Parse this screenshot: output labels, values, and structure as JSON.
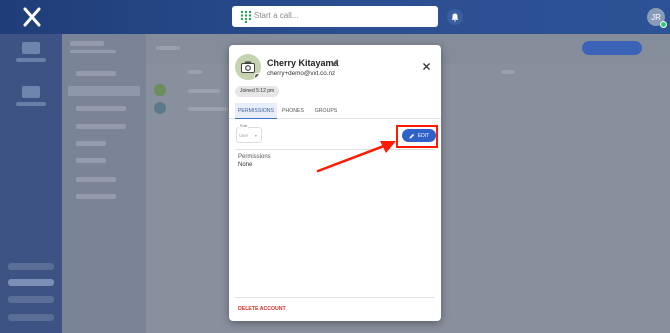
{
  "topbar": {
    "search_placeholder": "Start a call...",
    "user_initials": "JR"
  },
  "modal": {
    "name": "Cherry Kitayama",
    "email": "cherry+demo@vxt.co.nz",
    "joined": "Joined 5:12 pm",
    "tabs": [
      {
        "label": "PERMISSIONS",
        "active": true
      },
      {
        "label": "PHONES",
        "active": false
      },
      {
        "label": "GROUPS",
        "active": false
      }
    ],
    "role": {
      "label": "Role",
      "value": "User"
    },
    "edit_label": "EDIT",
    "permissions": {
      "title": "Permissions",
      "value": "None"
    },
    "delete_label": "DELETE ACCOUNT"
  },
  "colors": {
    "accent": "#2f62c8",
    "annotation": "#ff1a00",
    "danger": "#d93025"
  }
}
